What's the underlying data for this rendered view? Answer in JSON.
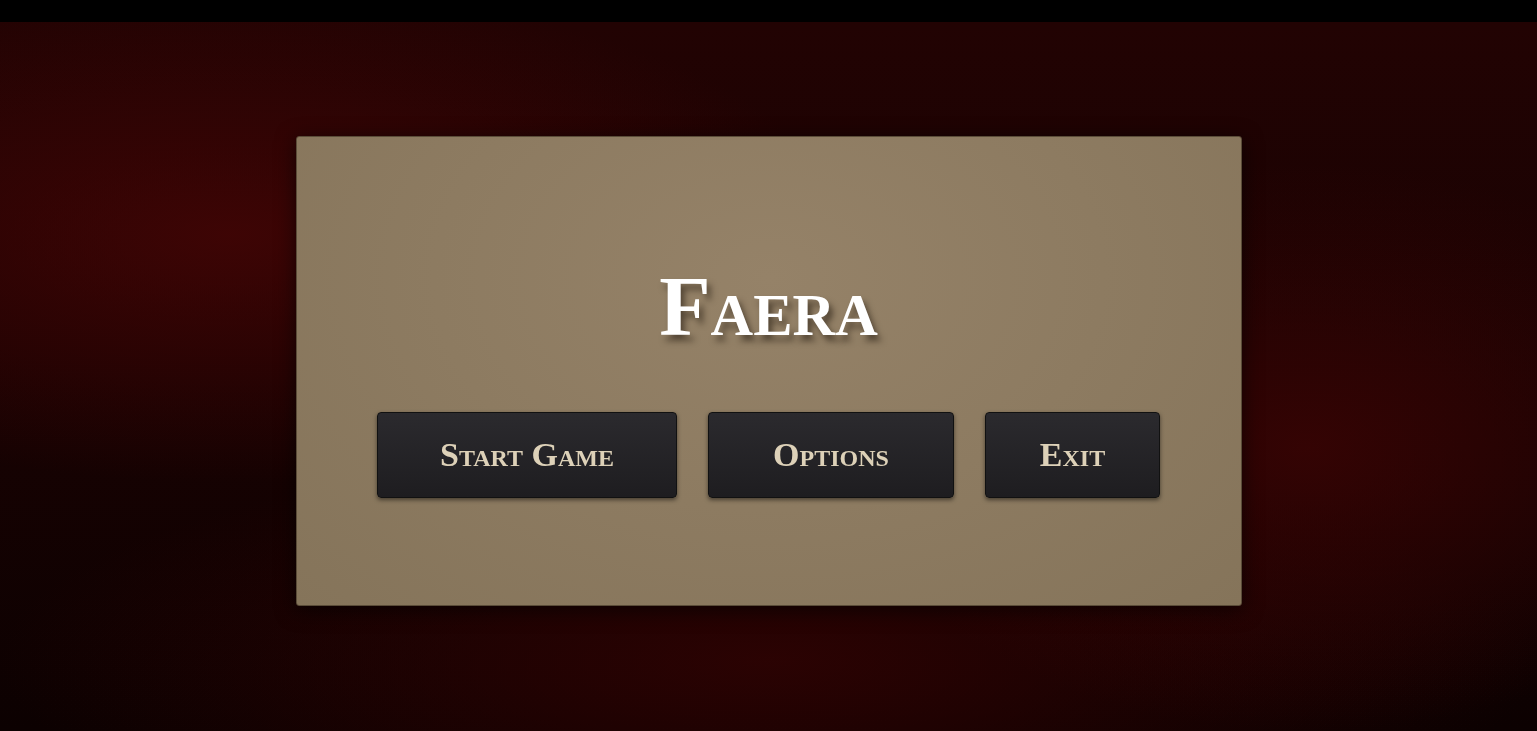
{
  "title": "Faera",
  "buttons": [
    {
      "label": "Start Game"
    },
    {
      "label": "Options"
    },
    {
      "label": "Exit"
    }
  ]
}
